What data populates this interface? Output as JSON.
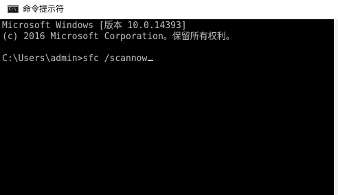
{
  "window": {
    "title": "命令提示符",
    "icon": "cmd-icon",
    "icon_text": "C:\\"
  },
  "console": {
    "lines": [
      "Microsoft Windows [版本 10.0.14393]",
      "(c) 2016 Microsoft Corporation。保留所有权利。",
      "C:\\Users\\admin>sfc /scannow"
    ]
  },
  "colors": {
    "console_bg": "#000000",
    "console_text": "#c0c0c0",
    "titlebar_bg": "#ffffff"
  }
}
